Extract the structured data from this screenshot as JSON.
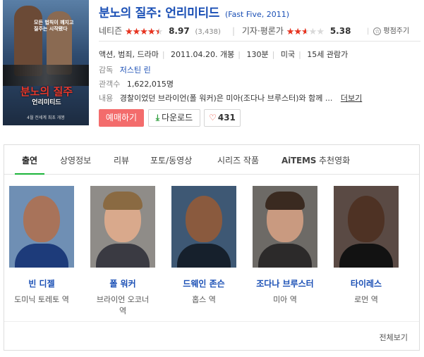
{
  "poster": {
    "title_ko": "분노의 질주",
    "title_sub": "언리미티드",
    "slogan": "모든 법칙이 깨지고 질주는 시작됐다",
    "date": "4월 전세계 최초 개봉"
  },
  "movie": {
    "title": "분노의 질주: 언리미티드",
    "title_en": "(Fast Five, 2011)"
  },
  "ratings": {
    "netizen": {
      "label": "네티즌",
      "score": "8.97",
      "fill": 0.897,
      "count": "(3,438)"
    },
    "critic": {
      "label": "기자·평론가",
      "score": "5.38",
      "fill": 0.538
    },
    "rate_button": {
      "label": "평점주기"
    }
  },
  "info": {
    "genres": "액션, 범죄, 드라마",
    "release": "2011.04.20. 개봉",
    "runtime": "130분",
    "country": "미국",
    "age": "15세 관람가",
    "director_label": "감독",
    "director": "저스틴 린",
    "audience_label": "관객수",
    "audience": "1,622,015명",
    "plot_label": "내용",
    "plot": "경찰이었던 브라이언(폴 워커)은 미아(조다나 브루스터)와 함께 ...",
    "more": "더보기"
  },
  "buttons": {
    "book": "예매하기",
    "download": "다운로드",
    "likes": "431"
  },
  "tabs": [
    {
      "label": "출연"
    },
    {
      "label": "상영정보"
    },
    {
      "label": "리뷰"
    },
    {
      "label": "포토/동영상"
    },
    {
      "label": "시리즈 작품"
    },
    {
      "label_brand": "AiTEMS",
      "label": "추천영화"
    }
  ],
  "cast": [
    {
      "name": "빈 디젤",
      "role": "도미닉 토레토 역"
    },
    {
      "name": "폴 워커",
      "role": "브라이언 오코너 역"
    },
    {
      "name": "드웨인 존슨",
      "role": "홉스 역"
    },
    {
      "name": "조다나 브루스터",
      "role": "미아 역"
    },
    {
      "name": "타이레스",
      "role": "로먼 역"
    }
  ],
  "all_view": "전체보기",
  "colors": {
    "link": "#1a4fb5",
    "star": "#e8331f",
    "book_button": "#f36c6c",
    "tab_active": "#1cb53a"
  }
}
